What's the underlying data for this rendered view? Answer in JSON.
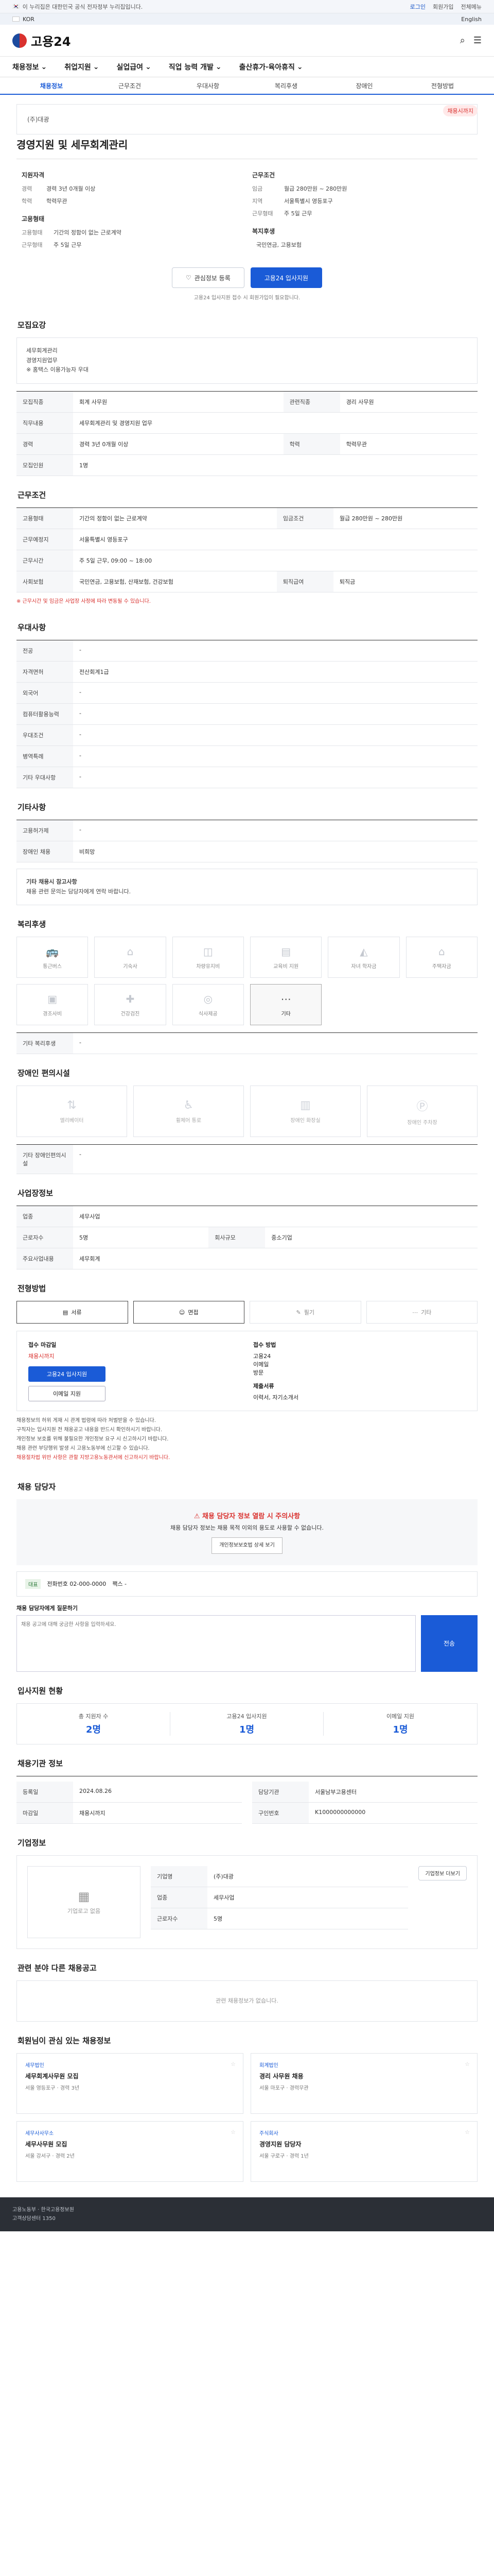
{
  "topbar": {
    "notice": "이 누리집은 대한민국 공식 전자정부 누리집입니다.",
    "links": [
      "로그인",
      "회원가입",
      "전체메뉴"
    ]
  },
  "gov": {
    "label": "KOR",
    "lang": "English"
  },
  "header": {
    "logo": "고용24"
  },
  "gnb": [
    "채용정보",
    "취업지원",
    "실업급여",
    "직업 능력 개발",
    "출산휴가·육아휴직"
  ],
  "lnb": [
    "채용정보",
    "근무조건",
    "우대사항",
    "복리후생",
    "장애인",
    "전형방법"
  ],
  "job": {
    "company": "(주)대광",
    "title": "경영지원 및 세무회계관리",
    "badge": "채용시까지",
    "summary_left_h": "지원자격",
    "summary_right_h": "근무조건",
    "left": [
      {
        "k": "경력",
        "v": "경력 3년 0개월 이상"
      },
      {
        "k": "학력",
        "v": "학력무관"
      }
    ],
    "right": [
      {
        "k": "임금",
        "v": "월급 280만원 ~ 280만원"
      },
      {
        "k": "지역",
        "v": "서울특별시 영등포구"
      },
      {
        "k": "근무형태",
        "v": "주 5일 근무"
      }
    ],
    "left2_h": "고용형태",
    "left2": [
      {
        "k": "고용형태",
        "v": "기간의 정함이 없는 근로계약"
      },
      {
        "k": "근무형태",
        "v": "주 5일 근무"
      }
    ],
    "right2_h": "복지후생",
    "right2": [
      {
        "k": "",
        "v": "국민연금, 고용보험"
      }
    ],
    "btn_scrap": "관심정보 등록",
    "btn_apply": "고용24 입사지원",
    "tiny": "고용24 입사지원 접수 시 회원가입이 필요합니다."
  },
  "recruit": {
    "h": "모집요강",
    "box": [
      "세무회계관리",
      "경영지원업무",
      "※ 홈택스 이용가능자 우대"
    ],
    "rows": [
      {
        "k": "모집직종",
        "v": "회계 사무원"
      },
      {
        "k": "관련직종",
        "v": "경리 사무원"
      },
      {
        "k": "직무내용",
        "v": "세무회계관리 및 경영지원 업무"
      },
      {
        "k": "경력",
        "v": "경력 3년 0개월 이상"
      },
      {
        "k": "학력",
        "v": "학력무관"
      },
      {
        "k": "모집인원",
        "v": "1명"
      }
    ]
  },
  "cond": {
    "h": "근무조건",
    "rows": [
      {
        "k": "고용형태",
        "v": "기간의 정함이 없는 근로계약"
      },
      {
        "k": "임금조건",
        "v": "월급 280만원 ~ 280만원"
      },
      {
        "k": "근무예정지",
        "v": "서울특별시 영등포구"
      },
      {
        "k": "근무시간",
        "v": "주 5일 근무, 09:00 ~ 18:00"
      },
      {
        "k": "사회보험",
        "v": "국민연금, 고용보험, 산재보험, 건강보험"
      },
      {
        "k": "퇴직급여",
        "v": "퇴직금"
      }
    ],
    "note": "※ 근무시간 및 임금은 사업장 사정에 따라 변동될 수 있습니다."
  },
  "pref": {
    "h": "우대사항",
    "rows": [
      {
        "k": "전공",
        "v": "-"
      },
      {
        "k": "자격면허",
        "v": "전산회계1급"
      },
      {
        "k": "외국어",
        "v": "-"
      },
      {
        "k": "컴퓨터활용능력",
        "v": "-"
      },
      {
        "k": "우대조건",
        "v": "-"
      },
      {
        "k": "병역특례",
        "v": "-"
      },
      {
        "k": "기타 우대사항",
        "v": "-"
      }
    ]
  },
  "etc": {
    "h": "기타사항",
    "rows": [
      {
        "k": "고용허가제",
        "v": "-"
      },
      {
        "k": "장애인 채용",
        "v": "비희망"
      }
    ],
    "box_h": "기타 채용시 참고사항",
    "box": "채용 관련 문의는 담당자에게 연락 바랍니다."
  },
  "welfare": {
    "h": "복리후생",
    "tiles": [
      "통근버스",
      "기숙사",
      "차량유지비",
      "교육비 지원",
      "자녀 학자금",
      "주택자금",
      "경조사비",
      "건강검진",
      "식사제공",
      "기타"
    ],
    "active": 9,
    "extra_h": "기타 복리후생",
    "extra": "-"
  },
  "disabled": {
    "h": "장애인 편의시설",
    "tiles": [
      "엘리베이터",
      "휠체어 통로",
      "장애인 화장실",
      "장애인 주차장"
    ],
    "extra_h": "기타 장애인편의시설",
    "extra": "-"
  },
  "workplace": {
    "h": "사업장정보",
    "rows": [
      {
        "k": "업종",
        "v": "세무사업"
      },
      {
        "k": "근로자수",
        "v": "5명"
      },
      {
        "k": "회사규모",
        "v": "중소기업"
      },
      {
        "k": "주요사업내용",
        "v": "세무회계"
      }
    ]
  },
  "process": {
    "h": "전형방법",
    "steps": [
      "서류",
      "면접",
      "필기",
      "기타"
    ],
    "active": [
      0,
      1
    ],
    "deadline_h": "접수 마감일",
    "deadline": "채용시까지",
    "method_h": "접수 방법",
    "methods": [
      "고용24",
      "이메일",
      "방문"
    ],
    "docs_h": "제출서류",
    "docs": "이력서, 자기소개서",
    "apply_btn": "고용24 입사지원",
    "email_btn": "이메일 지원",
    "bullets": [
      "채용정보의 허위 게재 시 관계 법령에 따라 처벌받을 수 있습니다.",
      "구직자는 입사지원 전 채용공고 내용을 반드시 확인하시기 바랍니다.",
      "개인정보 보호를 위해 불필요한 개인정보 요구 시 신고하시기 바랍니다.",
      "채용 관련 부당행위 발생 시 고용노동부에 신고할 수 있습니다.",
      "채용절차법 위반 사항은 관할 지방고용노동관서에 신고하시기 바랍니다."
    ]
  },
  "contact": {
    "h": "채용 담당자",
    "warn_h": "채용 담당자 정보 열람 시 주의사항",
    "warn": "채용 담당자 정보는 채용 목적 이외의 용도로 사용할 수 없습니다.",
    "warn_btn": "개인정보보호법 상세 보기",
    "tag": "대표",
    "info": "전화번호 02-000-0000",
    "fax": "팩스 -",
    "msg_h": "채용 담당자에게 질문하기",
    "msg_ph": "채용 공고에 대해 궁금한 사항을 입력하세요.",
    "send": "전송"
  },
  "stats": {
    "h": "입사지원 현황",
    "items": [
      {
        "label": "총 지원자 수",
        "value": "2명"
      },
      {
        "label": "고용24 입사지원",
        "value": "1명"
      },
      {
        "label": "이메일 지원",
        "value": "1명"
      }
    ]
  },
  "manage": {
    "h": "채용기관 정보",
    "left": [
      {
        "k": "등록일",
        "v": "2024.08.26"
      },
      {
        "k": "마감일",
        "v": "채용시까지"
      }
    ],
    "right": [
      {
        "k": "담당기관",
        "v": "서울남부고용센터"
      },
      {
        "k": "구인번호",
        "v": "K1000000000000"
      }
    ]
  },
  "companyinfo": {
    "h": "기업정보",
    "logo": "기업로고 없음",
    "rows": [
      {
        "k": "기업명",
        "v": "(주)대광"
      },
      {
        "k": "업종",
        "v": "세무사업"
      },
      {
        "k": "근로자수",
        "v": "5명"
      }
    ],
    "btn": "기업정보 더보기"
  },
  "similar": {
    "h": "관련 분야 다른 채용공고",
    "empty": "관련 채용정보가 없습니다."
  },
  "recommend": {
    "h": "회원님이 관심 있는 채용정보",
    "cards": [
      {
        "company": "세무법인",
        "title": "세무회계사무원 모집",
        "meta": "서울 영등포구 · 경력 3년"
      },
      {
        "company": "회계법인",
        "title": "경리 사무원 채용",
        "meta": "서울 마포구 · 경력무관"
      },
      {
        "company": "세무사사무소",
        "title": "세무사무원 모집",
        "meta": "서울 강서구 · 경력 2년"
      },
      {
        "company": "주식회사",
        "title": "경영지원 담당자",
        "meta": "서울 구로구 · 경력 1년"
      }
    ]
  },
  "footer": {
    "line1": "고용노동부 · 한국고용정보원",
    "line2": "고객상담센터 1350"
  }
}
